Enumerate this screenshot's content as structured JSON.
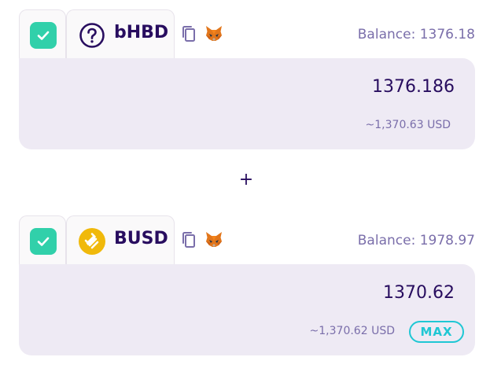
{
  "token_a": {
    "symbol": "bHBD",
    "balance": "Balance: 1376.18",
    "amount": "1376.186",
    "usd_value": "~1,370.63 USD",
    "icon": "question-icon",
    "checked": true
  },
  "separator": "+",
  "token_b": {
    "symbol": "BUSD",
    "balance": "Balance: 1978.97",
    "amount": "1370.62",
    "usd_value": "~1,370.62 USD",
    "max_label": "MAX",
    "icon": "busd-logo-icon",
    "checked": true
  },
  "colors": {
    "accent": "#1fc7d4",
    "success": "#31d0aa",
    "text": "#280d5f",
    "secondary_text": "#7a6eaa",
    "panel": "#eeeaf4",
    "busd": "#f0b90b"
  }
}
